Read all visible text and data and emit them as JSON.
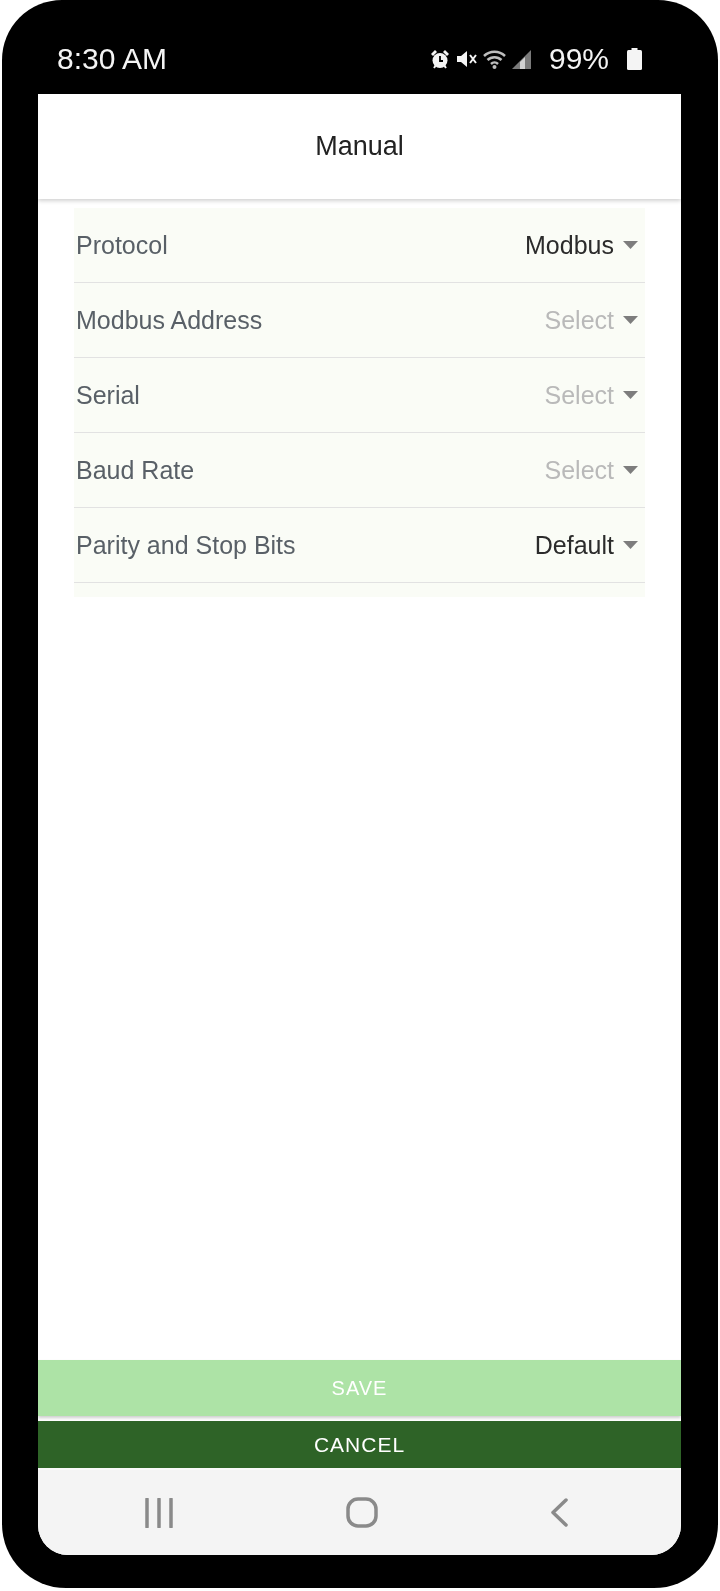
{
  "status_bar": {
    "time": "8:30 AM",
    "battery": "99%"
  },
  "header": {
    "title": "Manual"
  },
  "settings": [
    {
      "label": "Protocol",
      "value": "Modbus"
    },
    {
      "label": "Modbus Address",
      "placeholder": "Select"
    },
    {
      "label": "Serial",
      "placeholder": "Select"
    },
    {
      "label": "Baud Rate",
      "placeholder": "Select"
    },
    {
      "label": "Parity and Stop Bits",
      "value": "Default"
    }
  ],
  "buttons": [
    {
      "label": "SAVE",
      "disabled": true
    },
    {
      "label": "CANCEL",
      "disabled": false
    }
  ]
}
